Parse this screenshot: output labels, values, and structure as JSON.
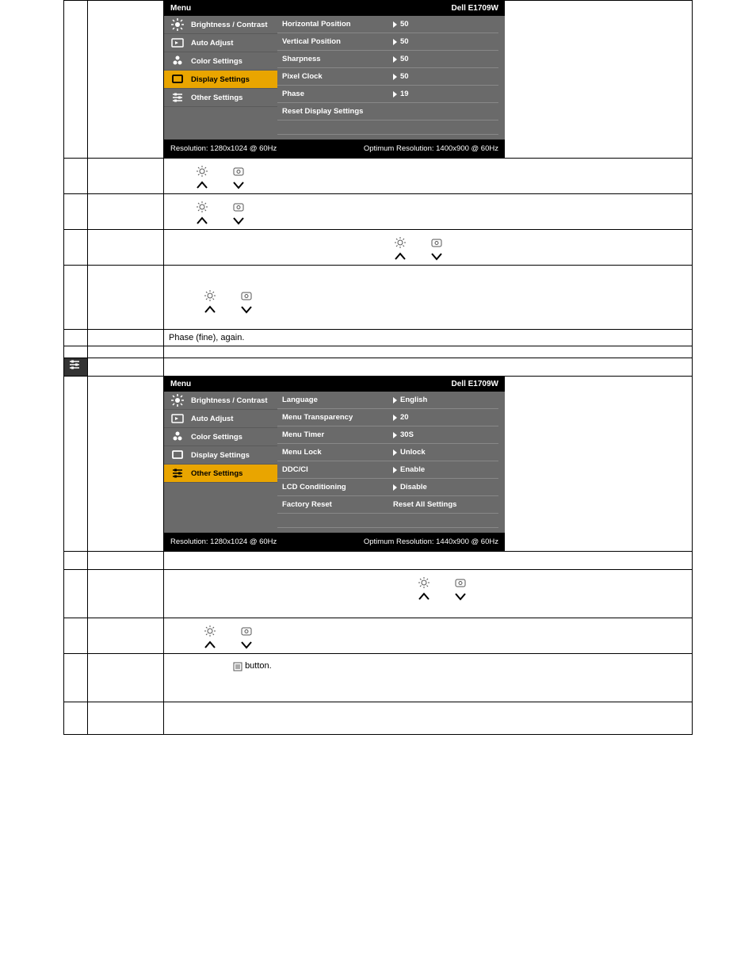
{
  "osd1": {
    "title": "Menu",
    "model": "Dell E1709W",
    "resolution": "Resolution: 1280x1024 @ 60Hz",
    "optimum": "Optimum Resolution: 1400x900 @ 60Hz",
    "menu": [
      {
        "label": "Brightness / Contrast",
        "icon": "brightness"
      },
      {
        "label": "Auto Adjust",
        "icon": "auto"
      },
      {
        "label": "Color Settings",
        "icon": "colors"
      },
      {
        "label": "Display Settings",
        "icon": "display",
        "selected": true
      },
      {
        "label": "Other Settings",
        "icon": "sliders"
      }
    ],
    "settings": [
      {
        "label": "Horizontal Position",
        "value": "50"
      },
      {
        "label": "Vertical Position",
        "value": "50"
      },
      {
        "label": "Sharpness",
        "value": "50"
      },
      {
        "label": "Pixel Clock",
        "value": "50"
      },
      {
        "label": "Phase",
        "value": "19"
      },
      {
        "label": "Reset Display Settings",
        "value": ""
      }
    ]
  },
  "osd2": {
    "title": "Menu",
    "model": "Dell E1709W",
    "resolution": "Resolution: 1280x1024 @ 60Hz",
    "optimum": "Optimum Resolution: 1440x900 @ 60Hz",
    "menu": [
      {
        "label": "Brightness / Contrast",
        "icon": "brightness"
      },
      {
        "label": "Auto Adjust",
        "icon": "auto"
      },
      {
        "label": "Color Settings",
        "icon": "colors"
      },
      {
        "label": "Display Settings",
        "icon": "display"
      },
      {
        "label": "Other Settings",
        "icon": "sliders",
        "selected": true
      }
    ],
    "settings": [
      {
        "label": "Language",
        "value": "English"
      },
      {
        "label": "Menu Transparency",
        "value": "20"
      },
      {
        "label": "Menu Timer",
        "value": "30S"
      },
      {
        "label": "Menu Lock",
        "value": "Unlock"
      },
      {
        "label": "DDC/CI",
        "value": "Enable"
      },
      {
        "label": "LCD Conditioning",
        "value": "Disable"
      },
      {
        "label": "Factory Reset",
        "value": "Reset All Settings",
        "noTri": true
      }
    ]
  },
  "text": {
    "phase_fine": "Phase (fine), again.",
    "button": " button."
  }
}
